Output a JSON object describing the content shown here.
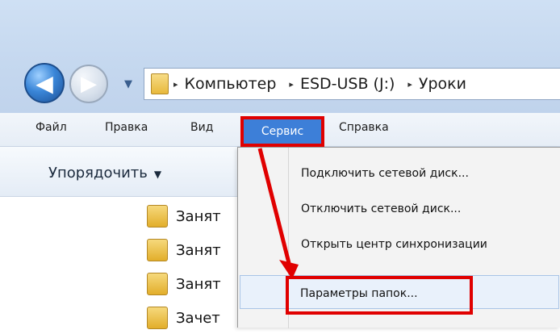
{
  "nav": {
    "back_glyph": "◀",
    "forward_glyph": "▶",
    "history_glyph": "▼"
  },
  "address": {
    "crumbs": [
      "Компьютер",
      "ESD-USB (J:)",
      "Уроки"
    ],
    "separator": "▸"
  },
  "menubar": {
    "items": [
      "Файл",
      "Правка",
      "Вид",
      "Сервис",
      "Справка"
    ],
    "active": "Сервис"
  },
  "toolbar": {
    "organize_label": "Упорядочить",
    "organize_caret": "▼"
  },
  "files": [
    "Занят",
    "Занят",
    "Занят",
    "Зачет"
  ],
  "dropdown": {
    "items": [
      "Подключить сетевой диск...",
      "Отключить сетевой диск...",
      "Открыть центр синхронизации",
      "Параметры папок..."
    ]
  },
  "colors": {
    "highlight": "#3d7fd8",
    "annotation": "#e00000"
  }
}
